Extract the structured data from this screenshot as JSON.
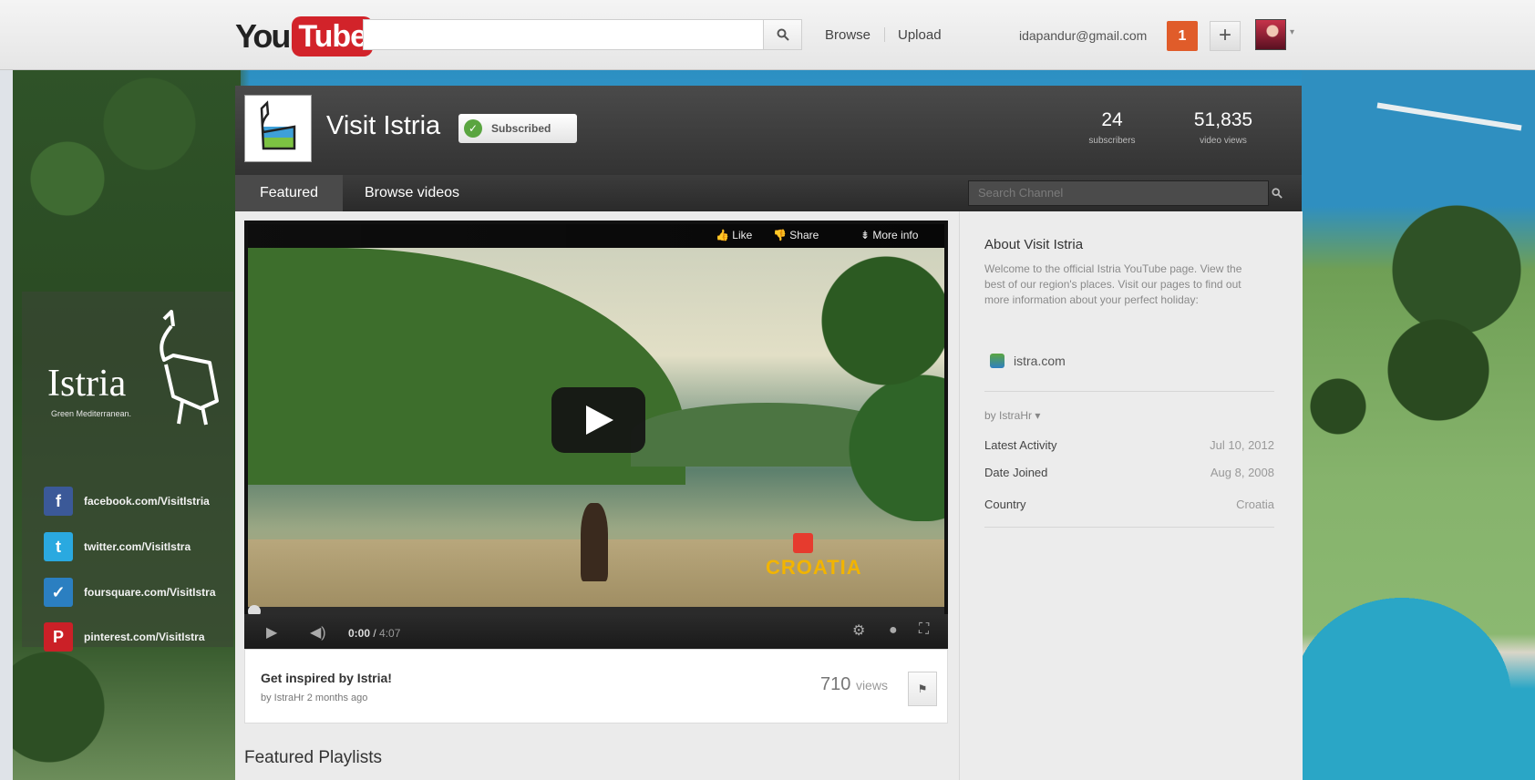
{
  "topbar": {
    "logo_you": "You",
    "logo_tube": "Tube",
    "search_value": "",
    "browse": "Browse",
    "upload": "Upload",
    "email": "idapandur@gmail.com",
    "notification_count": "1",
    "plus": "+"
  },
  "social": {
    "brand": "Istria",
    "tagline": "Green Mediterranean.",
    "links": [
      {
        "icon": "facebook-icon",
        "glyph": "f",
        "text": "facebook.com/VisitIstria",
        "color": "#3b5998"
      },
      {
        "icon": "twitter-icon",
        "glyph": "t",
        "text": "twitter.com/VisitIstra",
        "color": "#2aa9e0"
      },
      {
        "icon": "foursquare-icon",
        "glyph": "✓",
        "text": "foursquare.com/VisitIstra",
        "color": "#2b7fc1"
      },
      {
        "icon": "pinterest-icon",
        "glyph": "P",
        "text": "pinterest.com/VisitIstra",
        "color": "#cb2027"
      }
    ]
  },
  "channel": {
    "title": "Visit Istria",
    "subscribe_label": "Subscribed",
    "subscribers_count": "24",
    "subscribers_label": "subscribers",
    "views_count": "51,835",
    "views_label": "video views",
    "tabs": [
      "Featured",
      "Browse videos"
    ],
    "search_placeholder": "Search Channel"
  },
  "video": {
    "actions": {
      "like": "Like",
      "share": "Share",
      "more": "More info"
    },
    "watermark": "CROATIA",
    "time_current": "0:00",
    "time_duration": "4:07",
    "progress": 0,
    "title": "Get inspired by Istria!",
    "byline": "by IstraHr 2 months ago",
    "views_count": "710",
    "views_label": "views"
  },
  "featured_playlists": "Featured Playlists",
  "about": {
    "title": "About Visit Istria",
    "description": "Welcome to the official Istria YouTube page. View the best of our region's places. Visit our pages to find out more information about your perfect holiday:",
    "link": "istra.com",
    "by": "by IstraHr",
    "rows": [
      {
        "label": "Latest Activity",
        "value": "Jul 10, 2012"
      },
      {
        "label": "Date Joined",
        "value": "Aug 8, 2008"
      },
      {
        "label": "Country",
        "value": "Croatia"
      }
    ]
  },
  "colors": {
    "youtube_red": "#d2232a",
    "notification": "#e05c2a",
    "subscribed_green": "#5aa540"
  }
}
